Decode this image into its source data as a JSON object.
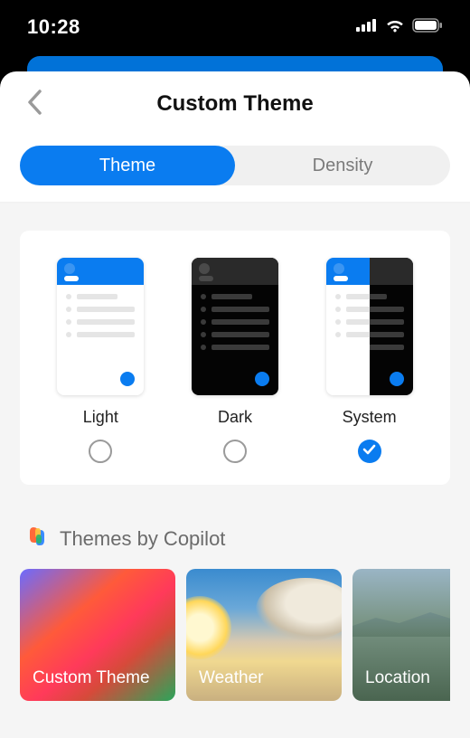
{
  "status": {
    "time": "10:28"
  },
  "header": {
    "title": "Custom Theme"
  },
  "segmented": {
    "theme": "Theme",
    "density": "Density",
    "active": "theme"
  },
  "themes": {
    "items": [
      {
        "key": "light",
        "label": "Light",
        "selected": false
      },
      {
        "key": "dark",
        "label": "Dark",
        "selected": false
      },
      {
        "key": "system",
        "label": "System",
        "selected": true
      }
    ]
  },
  "copilot": {
    "title": "Themes by Copilot",
    "cards": [
      {
        "key": "custom",
        "label": "Custom Theme"
      },
      {
        "key": "weather",
        "label": "Weather"
      },
      {
        "key": "location",
        "label": "Location"
      }
    ]
  }
}
